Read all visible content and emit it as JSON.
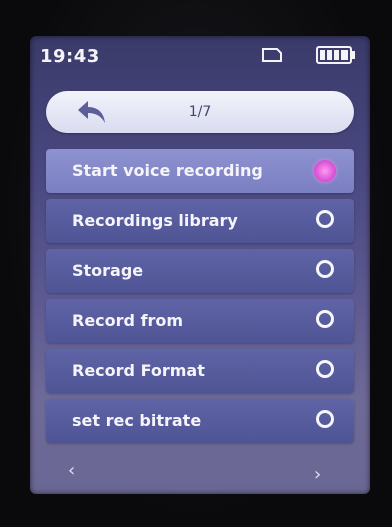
{
  "status_bar": {
    "time": "19:43",
    "sd_card_icon": "sd-card-icon",
    "battery_icon": "battery-full-icon"
  },
  "header": {
    "back_icon": "back-arrow-icon",
    "page_indicator": "1/7"
  },
  "menu": {
    "items": [
      {
        "label": "Start voice recording",
        "selected": true
      },
      {
        "label": "Recordings library",
        "selected": false
      },
      {
        "label": "Storage",
        "selected": false
      },
      {
        "label": "Record from",
        "selected": false
      },
      {
        "label": "Record Format",
        "selected": false
      },
      {
        "label": "set rec bitrate",
        "selected": false
      }
    ]
  },
  "pager": {
    "prev_symbol": "‹",
    "next_symbol": "›"
  },
  "colors": {
    "accent_selected_radio": "#e05ad8",
    "menu_item": "#555a9c",
    "menu_item_selected": "#8488c9",
    "back_bar": "#e6e8f6"
  }
}
